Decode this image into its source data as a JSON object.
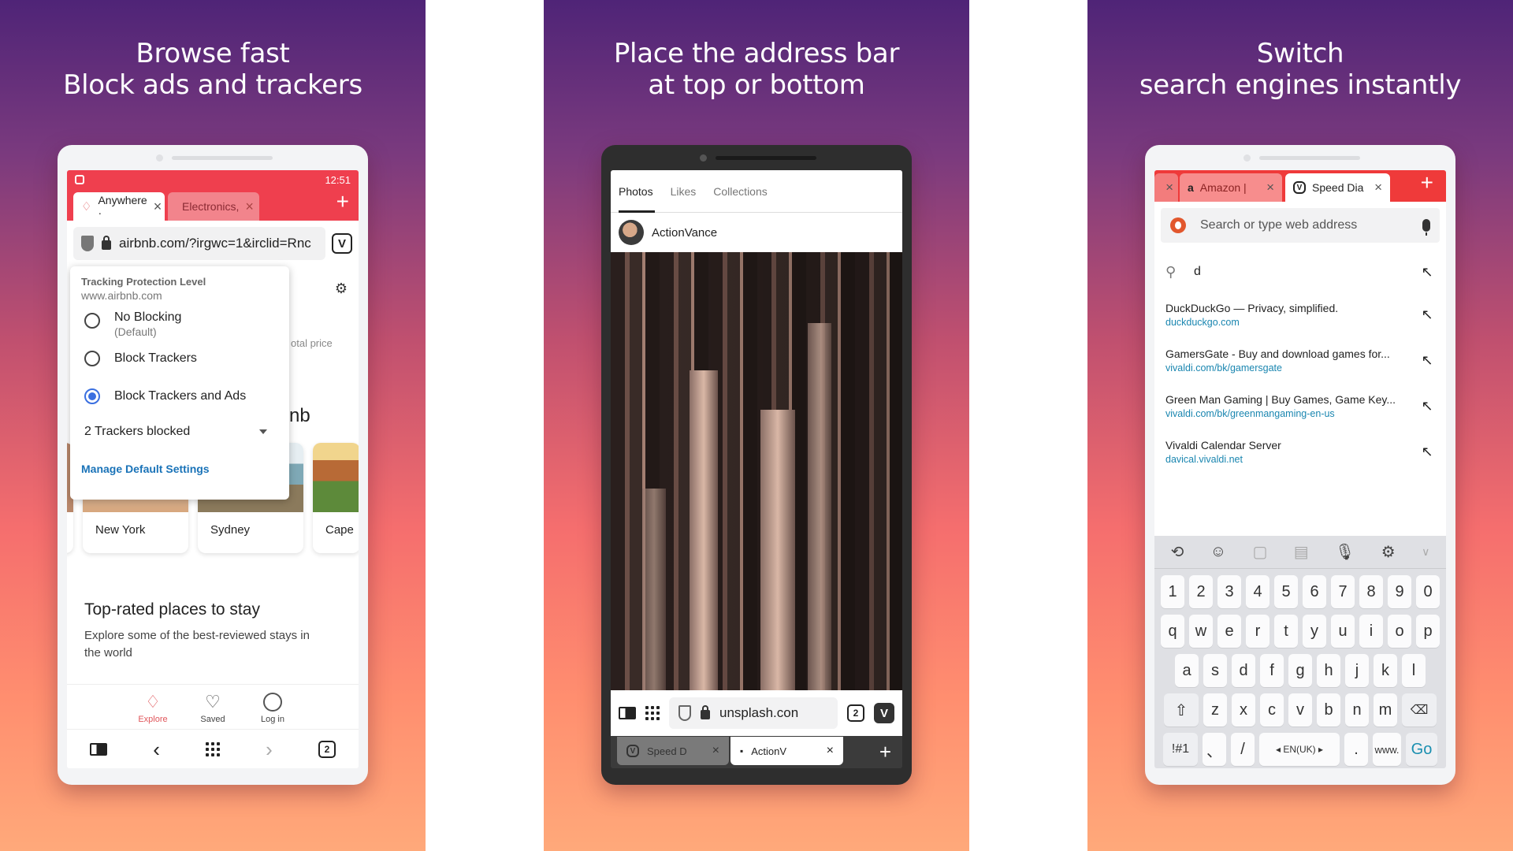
{
  "colors": {
    "accent_red": "#ef3f4e",
    "link_blue": "#1a73b8",
    "radio_blue": "#3a6fe0",
    "airbnb_pink": "#e0565b",
    "go_teal": "#1a8fb0"
  },
  "panels": [
    {
      "headline": [
        "Browse fast",
        "Block ads and trackers"
      ],
      "status_time": "12:51",
      "tabs": [
        {
          "label": "Anywhere · ",
          "icon": "airbnb-icon",
          "active": true
        },
        {
          "label": "Electronics,",
          "icon": "shopping-bag-icon",
          "active": false
        }
      ],
      "address": "airbnb.com/?irgwc=1&irclid=Rnc",
      "tracking_popup": {
        "title": "Tracking Protection Level",
        "site": "www.airbnb.com",
        "options": [
          {
            "label": "No Blocking",
            "sublabel": "(Default)",
            "selected": false
          },
          {
            "label": "Block Trackers",
            "sublabel": "",
            "selected": false
          },
          {
            "label": "Block Trackers and Ads",
            "sublabel": "",
            "selected": true
          }
        ],
        "trackers_blocked": "2 Trackers blocked",
        "manage_link": "Manage Default Settings"
      },
      "page": {
        "total_price_fragment": "otal price",
        "heading_fragment": "nb",
        "cards": [
          "New York",
          "Sydney",
          "Cape"
        ],
        "section_title": "Top-rated places to stay",
        "section_subtitle": "Explore some of the best-reviewed stays in the world",
        "nav": [
          {
            "label": "Explore",
            "icon": "airbnb-icon",
            "active": true
          },
          {
            "label": "Saved",
            "icon": "heart-icon",
            "active": false
          },
          {
            "label": "Log in",
            "icon": "user-circle-icon",
            "active": false
          }
        ]
      },
      "tab_count": "2"
    },
    {
      "headline": [
        "Place the address bar",
        "at top or bottom"
      ],
      "page_tabs": [
        "Photos",
        "Likes",
        "Collections"
      ],
      "username": "ActionVance",
      "address": "unsplash.con",
      "tab_count": "2",
      "bottom_tabs": [
        {
          "label": "Speed D",
          "active": false
        },
        {
          "label": "ActionV",
          "active": true
        }
      ]
    },
    {
      "headline": [
        "Switch",
        "search engines instantly"
      ],
      "tabs": [
        {
          "label": "Amazon |",
          "active": false
        },
        {
          "label": "Speed Dia",
          "active": true
        }
      ],
      "search_placeholder": "Search or type web address",
      "typed_query": "d",
      "suggestions": [
        {
          "title": "DuckDuckGo — Privacy, simplified.",
          "url": "duckduckgo.com"
        },
        {
          "title": "GamersGate - Buy and download games for...",
          "url": "vivaldi.com/bk/gamersgate"
        },
        {
          "title": "Green Man Gaming | Buy Games, Game Key...",
          "url": "vivaldi.com/bk/greenmangaming-en-us"
        },
        {
          "title": "Vivaldi Calendar Server",
          "url": "davical.vivaldi.net"
        }
      ],
      "keyboard": {
        "numbers": [
          "1",
          "2",
          "3",
          "4",
          "5",
          "6",
          "7",
          "8",
          "9",
          "0"
        ],
        "row1": [
          "q",
          "w",
          "e",
          "r",
          "t",
          "y",
          "u",
          "i",
          "o",
          "p"
        ],
        "row2": [
          "a",
          "s",
          "d",
          "f",
          "g",
          "h",
          "j",
          "k",
          "l"
        ],
        "row3": [
          "z",
          "x",
          "c",
          "v",
          "b",
          "n",
          "m"
        ],
        "symbols_key": "!#1",
        "comma_key": "、",
        "slash_key": "/",
        "space_label": "◂ EN(UK) ▸",
        "period_key": ".",
        "www_key": "www.",
        "go_key": "Go"
      }
    }
  ]
}
